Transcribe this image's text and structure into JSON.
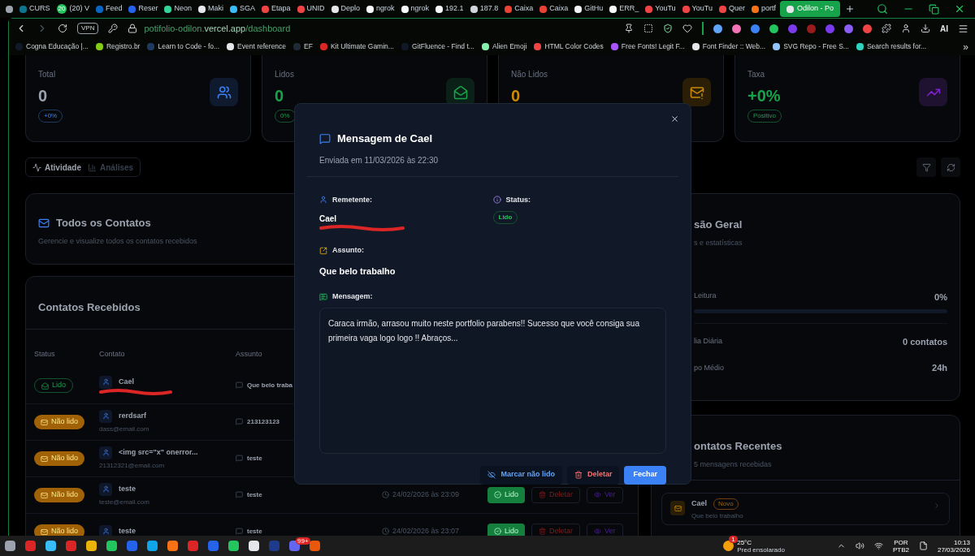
{
  "browser_tabs": [
    {
      "color": "#9ca3af",
      "selected": false
    },
    {
      "title": "CURS",
      "color": "#0e7490",
      "selected": false
    },
    {
      "title": "(20) V",
      "color": "#22c55e",
      "badge": "20",
      "selected": false
    },
    {
      "title": "Feed",
      "color": "#0a66c2",
      "selected": false
    },
    {
      "title": "Reser",
      "color": "#2563eb",
      "selected": false
    },
    {
      "title": "Neon",
      "color": "#34d399",
      "selected": false
    },
    {
      "title": "Maki",
      "color": "#e5e7eb",
      "selected": false
    },
    {
      "title": "SGA",
      "color": "#38bdf8",
      "selected": false
    },
    {
      "title": "Etapa",
      "color": "#ef4444",
      "selected": false
    },
    {
      "title": "UNID",
      "color": "#ef4444",
      "selected": false
    },
    {
      "title": "Deplo",
      "color": "#e5e7eb",
      "selected": false
    },
    {
      "title": "ngrok",
      "color": "#f9fafb",
      "selected": false
    },
    {
      "title": "ngrok",
      "color": "#f9fafb",
      "selected": false
    },
    {
      "title": "192.1",
      "color": "#f9fafb",
      "selected": false
    },
    {
      "title": "187.8",
      "color": "#d1d5db",
      "selected": false
    },
    {
      "title": "Caixa",
      "color": "#ea4335",
      "selected": false
    },
    {
      "title": "Caixa",
      "color": "#ea4335",
      "selected": false
    },
    {
      "title": "GitHu",
      "color": "#f3f4f6",
      "selected": false
    },
    {
      "title": "ERR_",
      "color": "#f9fafb",
      "selected": false
    },
    {
      "title": "YouTu",
      "color": "#ef4444",
      "selected": false
    },
    {
      "title": "YouTu",
      "color": "#ef4444",
      "selected": false
    },
    {
      "title": "Quer",
      "color": "#ef4444",
      "selected": false
    },
    {
      "title": "portf",
      "color": "#f97316",
      "selected": false
    },
    {
      "title": "Odilon - Po",
      "color": "#e5e7eb",
      "selected": true
    }
  ],
  "address_bar": {
    "vpn": "VPN",
    "url_start": "potifolio-odilon.",
    "url_domain": "vercel.app",
    "url_path": "/dashboard",
    "ai": "AI"
  },
  "bookmarks": [
    {
      "label": "Cogna Educação |...",
      "color": "#111827"
    },
    {
      "label": "Registro.br",
      "color": "#84cc16"
    },
    {
      "label": "Learn to Code - fo...",
      "color": "#1e3a5f"
    },
    {
      "label": "Event reference",
      "color": "#e5e7eb"
    },
    {
      "label": "EF",
      "color": "#1f2937"
    },
    {
      "label": "Kit Ultimate Gamin...",
      "color": "#dc2626"
    },
    {
      "label": "GitFluence - Find t...",
      "color": "#111827"
    },
    {
      "label": "Alien Emoji",
      "color": "#86efac"
    },
    {
      "label": "HTML Color Codes",
      "color": "#ef4444"
    },
    {
      "label": "Free Fonts! Legit F...",
      "color": "#a855f7"
    },
    {
      "label": "Font Finder :: Web...",
      "color": "#e5e7eb"
    },
    {
      "label": "SVG Repo - Free S...",
      "color": "#93c5fd"
    },
    {
      "label": "Search results for...",
      "color": "#2dd4bf"
    }
  ],
  "bookmarks_more": "»",
  "stats": [
    {
      "kind": "total",
      "label": "Total",
      "value": "0",
      "badge": "+0%"
    },
    {
      "kind": "read",
      "label": "Lidos",
      "value": "0",
      "badge": "0%"
    },
    {
      "kind": "unread",
      "label": "Não Lidos",
      "value": "0"
    },
    {
      "kind": "rate",
      "label": "Taxa",
      "value": "+0%",
      "badge": "Positivo"
    }
  ],
  "view_tabs": [
    {
      "label": "Atividade",
      "selected": true
    },
    {
      "label": "Análises",
      "selected": false
    }
  ],
  "all_contacts": {
    "title": "Todos os Contatos",
    "subtitle": "Gerencie e visualize todos os contatos recebidos"
  },
  "received": {
    "title": "Contatos Recebidos",
    "columns": [
      "Status",
      "Contato",
      "Assunto"
    ],
    "rows": [
      {
        "status": "Lido",
        "kind": "read",
        "name": "Cael",
        "email_redacted": true,
        "subject": "Que belo traba"
      },
      {
        "status": "Não lido",
        "kind": "unread",
        "name": "rerdsarf",
        "email": "dass@email.com",
        "subject": "213123123"
      },
      {
        "status": "Não lido",
        "kind": "unread",
        "name": "<img src=\"x\" onerror...",
        "email": "21312321@email.com",
        "subject": "teste"
      },
      {
        "status": "Não lido",
        "kind": "unread",
        "name": "teste",
        "email": "teste@email.com",
        "subject": "teste",
        "date": "24/02/2026 às 23:09",
        "actions": [
          "Lido",
          "Deletar",
          "Ver"
        ]
      },
      {
        "status": "Não lido",
        "kind": "unread",
        "name": "teste",
        "subject": "teste",
        "date": "24/02/2026 às 23:07",
        "actions": [
          "Lido",
          "Deletar",
          "Ver"
        ]
      }
    ]
  },
  "overview": {
    "title": "são Geral",
    "subtitle": "s e estatísticas",
    "rate_label": "Leitura",
    "rate_value": "0%",
    "level": 0,
    "rows": [
      {
        "label": "lia Diária",
        "value": "0 contatos"
      },
      {
        "label": "po Médio",
        "value": "24h"
      }
    ]
  },
  "recent": {
    "title": "ontatos Recentes",
    "subtitle": "5 mensagens recebidas",
    "items": [
      {
        "name": "Cael",
        "badge": "Novo",
        "subject": "Que belo trabalho"
      }
    ]
  },
  "modal": {
    "title": "Mensagem de Cael",
    "sent": "Enviada em 11/03/2026 às 22:30",
    "sender_label": "Remetente:",
    "sender": "Cael",
    "sender_email_redacted": true,
    "status_label": "Status:",
    "status": "Lido",
    "subject_label": "Assunto:",
    "subject": "Que belo trabalho",
    "message_label": "Mensagem:",
    "message": "Caraca irmão, arrasou muito neste portfolio parabens!! Sucesso que você consiga sua primeira vaga logo logo !! Abraços...",
    "buttons": [
      "Marcar não lido",
      "Deletar",
      "Fechar"
    ]
  },
  "taskbar": {
    "weather_badge": "1",
    "temperature": "25°C",
    "forecast": "Pred ensolarado",
    "chat_badge": "99+",
    "language": "POR",
    "layout": "PTB2",
    "time": "10:13",
    "date": "27/03/2026"
  }
}
